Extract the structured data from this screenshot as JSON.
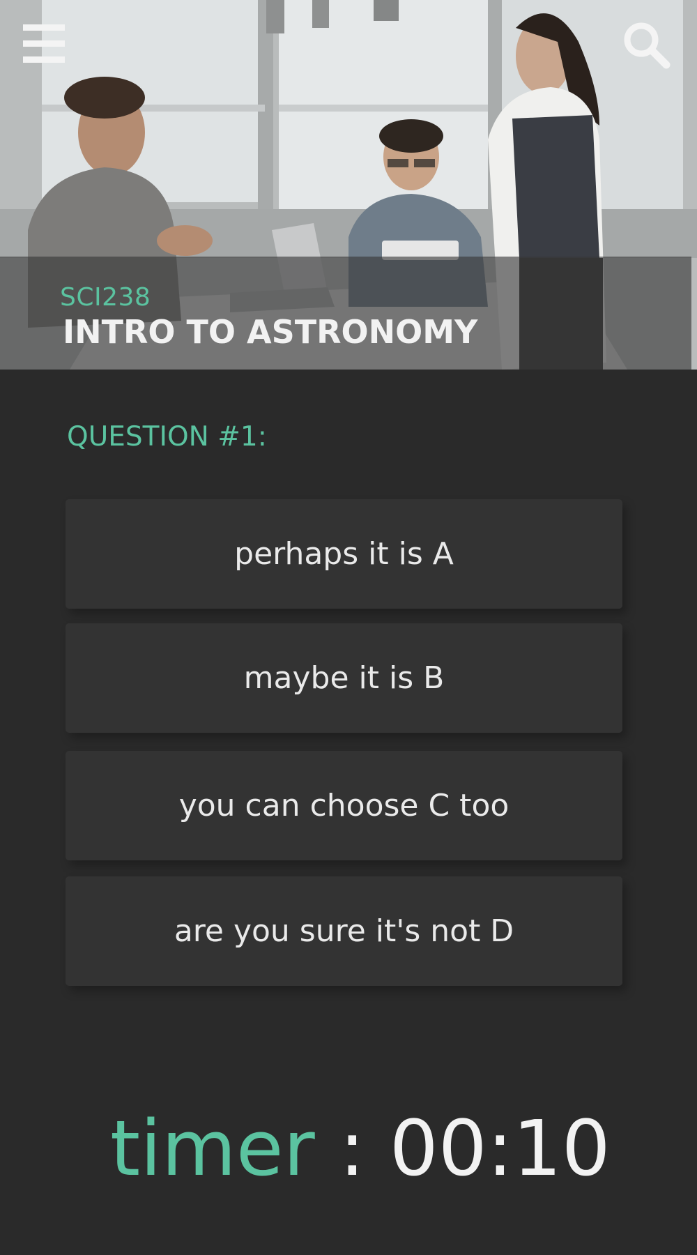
{
  "header": {
    "menu_icon": "hamburger-menu-icon",
    "search_icon": "search-icon"
  },
  "course": {
    "code": "SCI238",
    "title": "INTRO TO ASTRONOMY"
  },
  "question": {
    "heading": "QUESTION #1:",
    "answers": [
      {
        "label": "perhaps it is A"
      },
      {
        "label": "maybe it is B"
      },
      {
        "label": "you can choose C too"
      },
      {
        "label": "are you sure it's not D"
      }
    ]
  },
  "timer": {
    "label": "timer",
    "separator": ":",
    "value": "00:10"
  },
  "colors": {
    "accent": "#5bc3a0",
    "background": "#2a2a2a",
    "card": "#333333",
    "text": "#eaeaea"
  }
}
